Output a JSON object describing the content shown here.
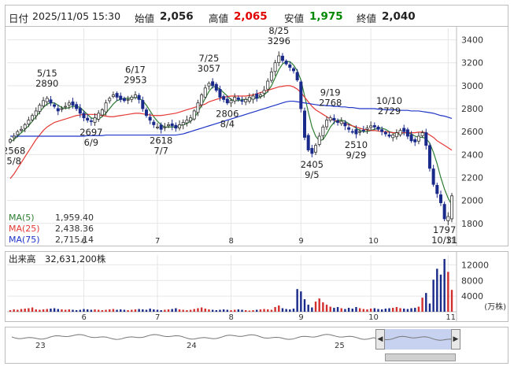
{
  "header": {
    "date_label": "日付",
    "date_value": "2025/11/05 15:30",
    "open_label": "始値",
    "open_value": "2,056",
    "high_label": "高値",
    "high_value": "2,065",
    "low_label": "安値",
    "low_value": "1,975",
    "close_label": "終値",
    "close_value": "2,040",
    "colors": {
      "high": "#e00000",
      "low": "#008800",
      "text": "#222222"
    }
  },
  "chart_data": [
    {
      "type": "candlestick",
      "ylim": [
        1620,
        3500
      ],
      "yticks": [
        1800,
        2000,
        2200,
        2400,
        2600,
        2800,
        3000,
        3200,
        3400
      ],
      "x_month_labels": [
        {
          "label": "6",
          "day": 20
        },
        {
          "label": "7",
          "day": 40
        },
        {
          "label": "8",
          "day": 60
        },
        {
          "label": "9",
          "day": 79
        },
        {
          "label": "10",
          "day": 98
        },
        {
          "label": "11",
          "day": 119
        }
      ],
      "ohlc_close_approx": [
        2530,
        2560,
        2600,
        2620,
        2660,
        2700,
        2740,
        2780,
        2830,
        2870,
        2890,
        2850,
        2820,
        2780,
        2800,
        2820,
        2850,
        2830,
        2800,
        2760,
        2720,
        2700,
        2690,
        2720,
        2760,
        2790,
        2850,
        2890,
        2920,
        2900,
        2880,
        2870,
        2880,
        2900,
        2920,
        2880,
        2800,
        2740,
        2700,
        2660,
        2640,
        2620,
        2640,
        2660,
        2650,
        2630,
        2660,
        2680,
        2700,
        2720,
        2780,
        2850,
        2920,
        2980,
        3020,
        3000,
        2960,
        2900,
        2880,
        2850,
        2870,
        2900,
        2880,
        2870,
        2880,
        2900,
        2910,
        2890,
        2920,
        2960,
        3040,
        3120,
        3200,
        3260,
        3220,
        3190,
        3160,
        3130,
        3050,
        2800,
        2550,
        2440,
        2410,
        2480,
        2560,
        2640,
        2700,
        2720,
        2700,
        2680,
        2690,
        2650,
        2620,
        2600,
        2580,
        2600,
        2610,
        2630,
        2650,
        2640,
        2620,
        2600,
        2580,
        2560,
        2570,
        2590,
        2610,
        2600,
        2560,
        2520,
        2510,
        2560,
        2590,
        2480,
        2280,
        2140,
        2060,
        1980,
        1840,
        1860,
        2040
      ],
      "series": [
        {
          "name": "MA(5)",
          "value": "1,959.40",
          "color": "#2e7d32",
          "values": [
            2510,
            2530,
            2560,
            2590,
            2620,
            2650,
            2690,
            2730,
            2770,
            2810,
            2840,
            2850,
            2850,
            2830,
            2810,
            2800,
            2810,
            2820,
            2820,
            2810,
            2780,
            2750,
            2720,
            2710,
            2710,
            2730,
            2760,
            2800,
            2840,
            2870,
            2880,
            2890,
            2890,
            2890,
            2900,
            2890,
            2870,
            2830,
            2780,
            2730,
            2690,
            2660,
            2640,
            2640,
            2640,
            2640,
            2650,
            2660,
            2670,
            2690,
            2720,
            2770,
            2830,
            2890,
            2950,
            2990,
            2990,
            2970,
            2940,
            2910,
            2880,
            2870,
            2870,
            2880,
            2880,
            2880,
            2890,
            2890,
            2900,
            2920,
            2950,
            3000,
            3070,
            3140,
            3190,
            3210,
            3210,
            3180,
            3130,
            3050,
            2910,
            2770,
            2640,
            2560,
            2520,
            2530,
            2580,
            2640,
            2680,
            2700,
            2700,
            2690,
            2670,
            2650,
            2630,
            2610,
            2600,
            2600,
            2610,
            2620,
            2630,
            2630,
            2620,
            2600,
            2590,
            2580,
            2580,
            2590,
            2590,
            2580,
            2560,
            2550,
            2550,
            2540,
            2500,
            2420,
            2320,
            2200,
            2100,
            2020,
            1959
          ]
        },
        {
          "name": "MA(25)",
          "value": "2,438.36",
          "color": "#e53935",
          "values": [
            2190,
            2230,
            2280,
            2330,
            2380,
            2430,
            2480,
            2530,
            2570,
            2610,
            2640,
            2660,
            2680,
            2690,
            2700,
            2710,
            2720,
            2730,
            2740,
            2745,
            2750,
            2750,
            2750,
            2750,
            2745,
            2740,
            2735,
            2730,
            2730,
            2735,
            2740,
            2745,
            2750,
            2755,
            2760,
            2760,
            2755,
            2750,
            2745,
            2740,
            2740,
            2740,
            2745,
            2750,
            2755,
            2760,
            2770,
            2780,
            2790,
            2800,
            2810,
            2820,
            2830,
            2840,
            2860,
            2870,
            2880,
            2890,
            2900,
            2905,
            2910,
            2910,
            2910,
            2910,
            2910,
            2915,
            2920,
            2930,
            2940,
            2950,
            2960,
            2970,
            2980,
            2990,
            2995,
            3000,
            3000,
            2990,
            2970,
            2940,
            2900,
            2860,
            2820,
            2790,
            2770,
            2750,
            2730,
            2710,
            2700,
            2690,
            2680,
            2670,
            2660,
            2650,
            2640,
            2630,
            2620,
            2615,
            2610,
            2610,
            2605,
            2600,
            2600,
            2595,
            2590,
            2590,
            2590,
            2590,
            2590,
            2590,
            2590,
            2595,
            2595,
            2590,
            2570,
            2550,
            2520,
            2500,
            2480,
            2460,
            2438
          ]
        },
        {
          "name": "MA(75)",
          "value": "2,715.14",
          "color": "#1e35c8",
          "values": [
            2560,
            2560,
            2560,
            2560,
            2560,
            2560,
            2560,
            2560,
            2560,
            2560,
            2560,
            2560,
            2560,
            2560,
            2560,
            2560,
            2560,
            2560,
            2560,
            2560,
            2560,
            2565,
            2565,
            2565,
            2565,
            2565,
            2570,
            2570,
            2570,
            2570,
            2570,
            2570,
            2570,
            2570,
            2570,
            2570,
            2570,
            2570,
            2570,
            2570,
            2570,
            2570,
            2570,
            2570,
            2570,
            2570,
            2575,
            2580,
            2590,
            2600,
            2610,
            2620,
            2630,
            2640,
            2650,
            2660,
            2670,
            2680,
            2690,
            2700,
            2710,
            2720,
            2730,
            2740,
            2750,
            2760,
            2770,
            2780,
            2790,
            2800,
            2810,
            2820,
            2830,
            2840,
            2850,
            2860,
            2865,
            2865,
            2860,
            2855,
            2850,
            2845,
            2840,
            2835,
            2830,
            2830,
            2825,
            2825,
            2820,
            2820,
            2815,
            2815,
            2810,
            2810,
            2805,
            2800,
            2800,
            2800,
            2800,
            2800,
            2795,
            2795,
            2790,
            2790,
            2790,
            2790,
            2785,
            2785,
            2785,
            2780,
            2780,
            2780,
            2775,
            2770,
            2765,
            2760,
            2750,
            2740,
            2735,
            2725,
            2715
          ]
        }
      ],
      "annotations": [
        {
          "day": 1,
          "price": 2530,
          "label": "2568",
          "date": "5/8",
          "pos": "below"
        },
        {
          "day": 10,
          "price": 2890,
          "label": "2890",
          "date": "5/15",
          "pos": "above"
        },
        {
          "day": 22,
          "price": 2690,
          "label": "2697",
          "date": "6/9",
          "pos": "below"
        },
        {
          "day": 34,
          "price": 2920,
          "label": "2953",
          "date": "6/17",
          "pos": "above"
        },
        {
          "day": 41,
          "price": 2620,
          "label": "2618",
          "date": "7/7",
          "pos": "below"
        },
        {
          "day": 54,
          "price": 3020,
          "label": "3057",
          "date": "7/25",
          "pos": "above"
        },
        {
          "day": 59,
          "price": 2850,
          "label": "2806",
          "date": "8/4",
          "pos": "below"
        },
        {
          "day": 73,
          "price": 3260,
          "label": "3296",
          "date": "8/25",
          "pos": "above"
        },
        {
          "day": 82,
          "price": 2410,
          "label": "2405",
          "date": "9/5",
          "pos": "below"
        },
        {
          "day": 87,
          "price": 2720,
          "label": "2768",
          "date": "9/19",
          "pos": "above"
        },
        {
          "day": 94,
          "price": 2580,
          "label": "2510",
          "date": "9/29",
          "pos": "below"
        },
        {
          "day": 103,
          "price": 2650,
          "label": "2729",
          "date": "10/10",
          "pos": "above"
        },
        {
          "day": 118,
          "price": 1840,
          "label": "1797",
          "date": "10/31",
          "pos": "below"
        }
      ]
    },
    {
      "type": "bar",
      "title": "出来高",
      "value": "32,631,200株",
      "unit": "(万株)",
      "yticks": [
        4000,
        8000,
        12000
      ],
      "ylim": [
        0,
        14500
      ],
      "values": [
        400,
        600,
        500,
        700,
        800,
        900,
        1100,
        600,
        500,
        600,
        700,
        800,
        900,
        700,
        600,
        500,
        600,
        500,
        400,
        500,
        700,
        600,
        500,
        600,
        500,
        400,
        500,
        600,
        700,
        500,
        600,
        500,
        400,
        500,
        600,
        700,
        600,
        500,
        800,
        600,
        500,
        400,
        500,
        600,
        700,
        900,
        600,
        500,
        400,
        500,
        700,
        900,
        1100,
        800,
        600,
        500,
        400,
        500,
        600,
        500,
        400,
        500,
        600,
        500,
        400,
        300,
        400,
        500,
        600,
        700,
        600,
        500,
        1200,
        1600,
        900,
        700,
        600,
        800,
        5800,
        5200,
        3200,
        1800,
        1100,
        2600,
        3400,
        2400,
        1800,
        1300,
        1000,
        1200,
        900,
        700,
        1000,
        800,
        1200,
        900,
        700,
        600,
        800,
        900,
        700,
        600,
        800,
        900,
        1000,
        1200,
        900,
        800,
        700,
        900,
        1000,
        1300,
        3600,
        4800,
        2100,
        8200,
        11000,
        9500,
        13500,
        10200,
        5600
      ]
    }
  ],
  "navigator": {
    "labels": [
      "23",
      "24",
      "25"
    ]
  }
}
